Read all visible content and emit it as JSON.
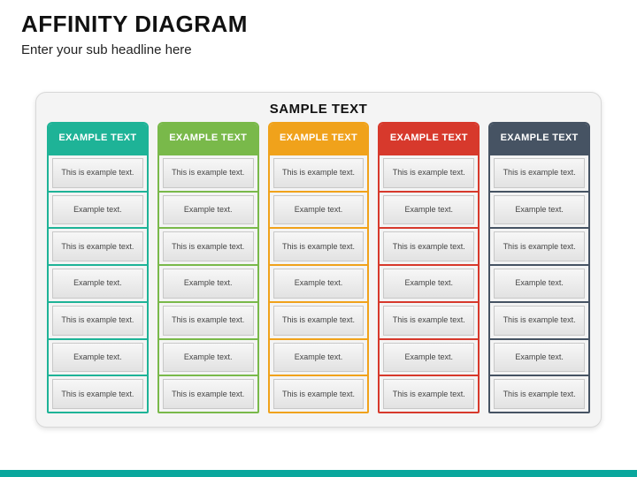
{
  "title": "AFFINITY DIAGRAM",
  "subtitle": "Enter your sub headline here",
  "panel_title": "SAMPLE TEXT",
  "columns": [
    {
      "header": "EXAMPLE TEXT",
      "color": "#1eb397",
      "items": [
        "This is example text.",
        "Example text.",
        "This is example text.",
        "Example text.",
        "This is example text.",
        "Example text.",
        "This is example text."
      ]
    },
    {
      "header": "EXAMPLE TEXT",
      "color": "#79b94a",
      "items": [
        "This is example text.",
        "Example text.",
        "This is example text.",
        "Example text.",
        "This is example text.",
        "Example text.",
        "This is example text."
      ]
    },
    {
      "header": "EXAMPLE TEXT",
      "color": "#f0a21b",
      "items": [
        "This is example text.",
        "Example text.",
        "This is example text.",
        "Example text.",
        "This is example text.",
        "Example text.",
        "This is example text."
      ]
    },
    {
      "header": "EXAMPLE TEXT",
      "color": "#d7392c",
      "items": [
        "This is example text.",
        "Example text.",
        "This is example text.",
        "Example text.",
        "This is example text.",
        "Example text.",
        "This is example text."
      ]
    },
    {
      "header": "EXAMPLE TEXT",
      "color": "#465363",
      "items": [
        "This is example text.",
        "Example text.",
        "This is example text.",
        "Example text.",
        "This is example text.",
        "Example text.",
        "This is example text."
      ]
    }
  ],
  "footer_color": "#0aa79d"
}
